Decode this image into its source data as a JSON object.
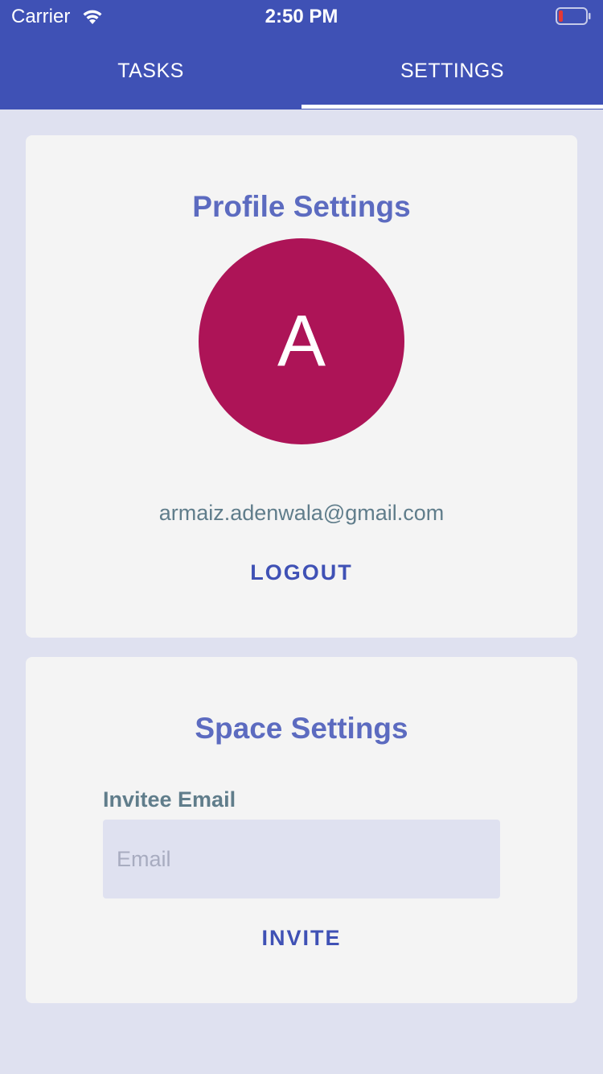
{
  "status_bar": {
    "carrier": "Carrier",
    "time": "2:50 PM",
    "icons": [
      "wifi-icon",
      "battery-icon"
    ],
    "battery_color": "#e53935"
  },
  "tabs": [
    {
      "label": "TASKS",
      "active": false
    },
    {
      "label": "SETTINGS",
      "active": true
    }
  ],
  "profile": {
    "title": "Profile Settings",
    "avatar_letter": "A",
    "avatar_color": "#ad1457",
    "email": "armaiz.adenwala@gmail.com",
    "logout_label": "LOGOUT"
  },
  "space": {
    "title": "Space Settings",
    "field_label": "Invitee Email",
    "email_placeholder": "Email",
    "email_value": "",
    "invite_label": "INVITE"
  },
  "colors": {
    "primary": "#3f51b5",
    "title": "#5c6bc0",
    "background": "#dfe1f0",
    "card": "#f4f4f4",
    "muted_text": "#607d8b"
  }
}
